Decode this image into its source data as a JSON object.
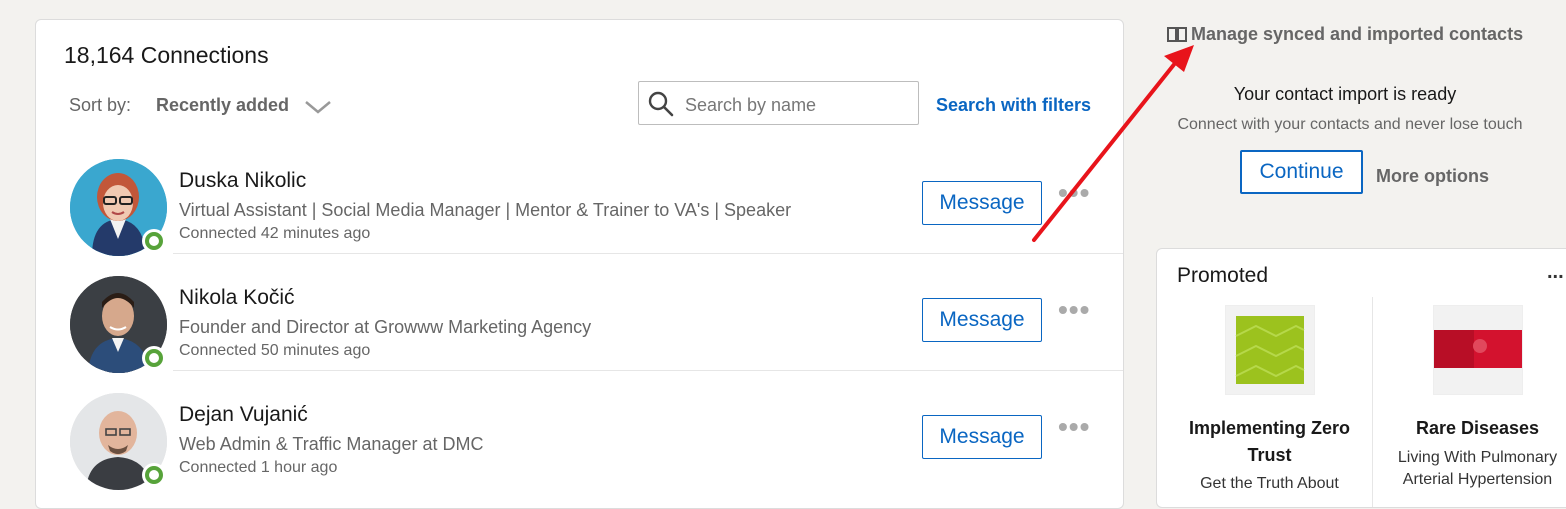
{
  "connections": {
    "count_label": "18,164 Connections",
    "sort_label": "Sort by:",
    "sort_value": "Recently added",
    "search_placeholder": "Search by name",
    "search_filters_label": "Search with filters",
    "message_label": "Message",
    "items": [
      {
        "name": "Duska Nikolic",
        "headline": "Virtual Assistant | Social Media Manager | Mentor & Trainer to VA's | Speaker",
        "connected": "Connected 42 minutes ago"
      },
      {
        "name": "Nikola Kočić",
        "headline": "Founder and Director at Growww Marketing Agency",
        "connected": "Connected 50 minutes ago"
      },
      {
        "name": "Dejan Vujanić",
        "headline": "Web Admin & Traffic Manager at DMC",
        "connected": "Connected 1 hour ago"
      }
    ]
  },
  "sidebar": {
    "manage_link": "Manage synced and imported contacts",
    "import_title": "Your contact import is ready",
    "import_subtitle": "Connect with your contacts and never lose touch",
    "continue_label": "Continue",
    "more_options_label": "More options"
  },
  "promoted": {
    "title": "Promoted",
    "more_label": "...",
    "items": [
      {
        "title_lines": [
          "Implementing Zero",
          "Trust"
        ],
        "subtitle_lines": [
          "Get the Truth About"
        ]
      },
      {
        "title_lines": [
          "Rare Diseases"
        ],
        "subtitle_lines": [
          "Living With Pulmonary",
          "Arterial Hypertension"
        ]
      }
    ]
  },
  "colors": {
    "brand_blue": "#0a66c2",
    "presence_green": "#57a33a",
    "annotation_arrow": "#e8141b"
  }
}
